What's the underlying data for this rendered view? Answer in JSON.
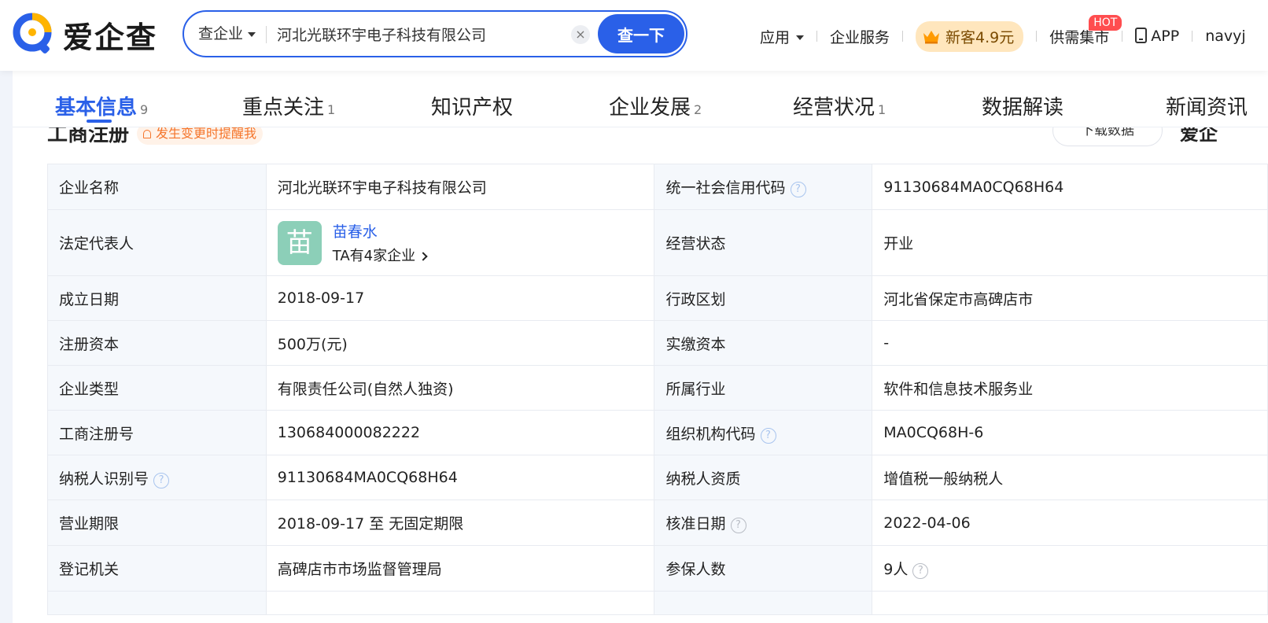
{
  "header": {
    "logo_text": "爱企查",
    "search": {
      "type_label": "查企业",
      "query": "河北光联环宇电子科技有限公司",
      "clear_glyph": "×",
      "button_label": "查一下"
    },
    "nav": {
      "apps": "应用",
      "services": "企业服务",
      "promo": "新客4.9元",
      "market": "供需集市",
      "hot_badge": "HOT",
      "app": "APP",
      "user": "navyj"
    }
  },
  "tabs": [
    {
      "label": "基本信息",
      "count": "9"
    },
    {
      "label": "重点关注",
      "count": "1"
    },
    {
      "label": "知识产权",
      "count": ""
    },
    {
      "label": "企业发展",
      "count": "2"
    },
    {
      "label": "经营状况",
      "count": "1"
    },
    {
      "label": "数据解读",
      "count": ""
    },
    {
      "label": "新闻资讯",
      "count": ""
    }
  ],
  "section": {
    "title": "工商注册",
    "remind": "发生变更时提醒我",
    "download": "下载数据",
    "side_logo": "爱企"
  },
  "table": {
    "rows": [
      {
        "l1": "企业名称",
        "v1": "河北光联环宇电子科技有限公司",
        "l2": "统一社会信用代码",
        "v2": "91130684MA0CQ68H64"
      },
      {
        "l1": "法定代表人",
        "v1": "",
        "l2": "经营状态",
        "v2": "开业"
      },
      {
        "l1": "成立日期",
        "v1": "2018-09-17",
        "l2": "行政区划",
        "v2": "河北省保定市高碑店市"
      },
      {
        "l1": "注册资本",
        "v1": "500万(元)",
        "l2": "实缴资本",
        "v2": "-"
      },
      {
        "l1": "企业类型",
        "v1": "有限责任公司(自然人独资)",
        "l2": "所属行业",
        "v2": "软件和信息技术服务业"
      },
      {
        "l1": "工商注册号",
        "v1": "130684000082222",
        "l2": "组织机构代码",
        "v2": "MA0CQ68H-6"
      },
      {
        "l1": "纳税人识别号",
        "v1": "91130684MA0CQ68H64",
        "l2": "纳税人资质",
        "v2": "增值税一般纳税人"
      },
      {
        "l1": "营业期限",
        "v1": "2018-09-17 至 无固定期限",
        "l2": "核准日期",
        "v2": "2022-04-06"
      },
      {
        "l1": "登记机关",
        "v1": "高碑店市市场监督管理局",
        "l2": "参保人数",
        "v2": "9人"
      }
    ],
    "legal_rep": {
      "avatar_char": "苗",
      "name": "苗春水",
      "companies": "TA有4家企业"
    },
    "help_glyph": "?"
  },
  "colors": {
    "brand_blue": "#2a60e8",
    "avatar_green": "#8ccfb8",
    "remind_orange": "#f5752b",
    "hot_red": "#ff4d4f"
  }
}
